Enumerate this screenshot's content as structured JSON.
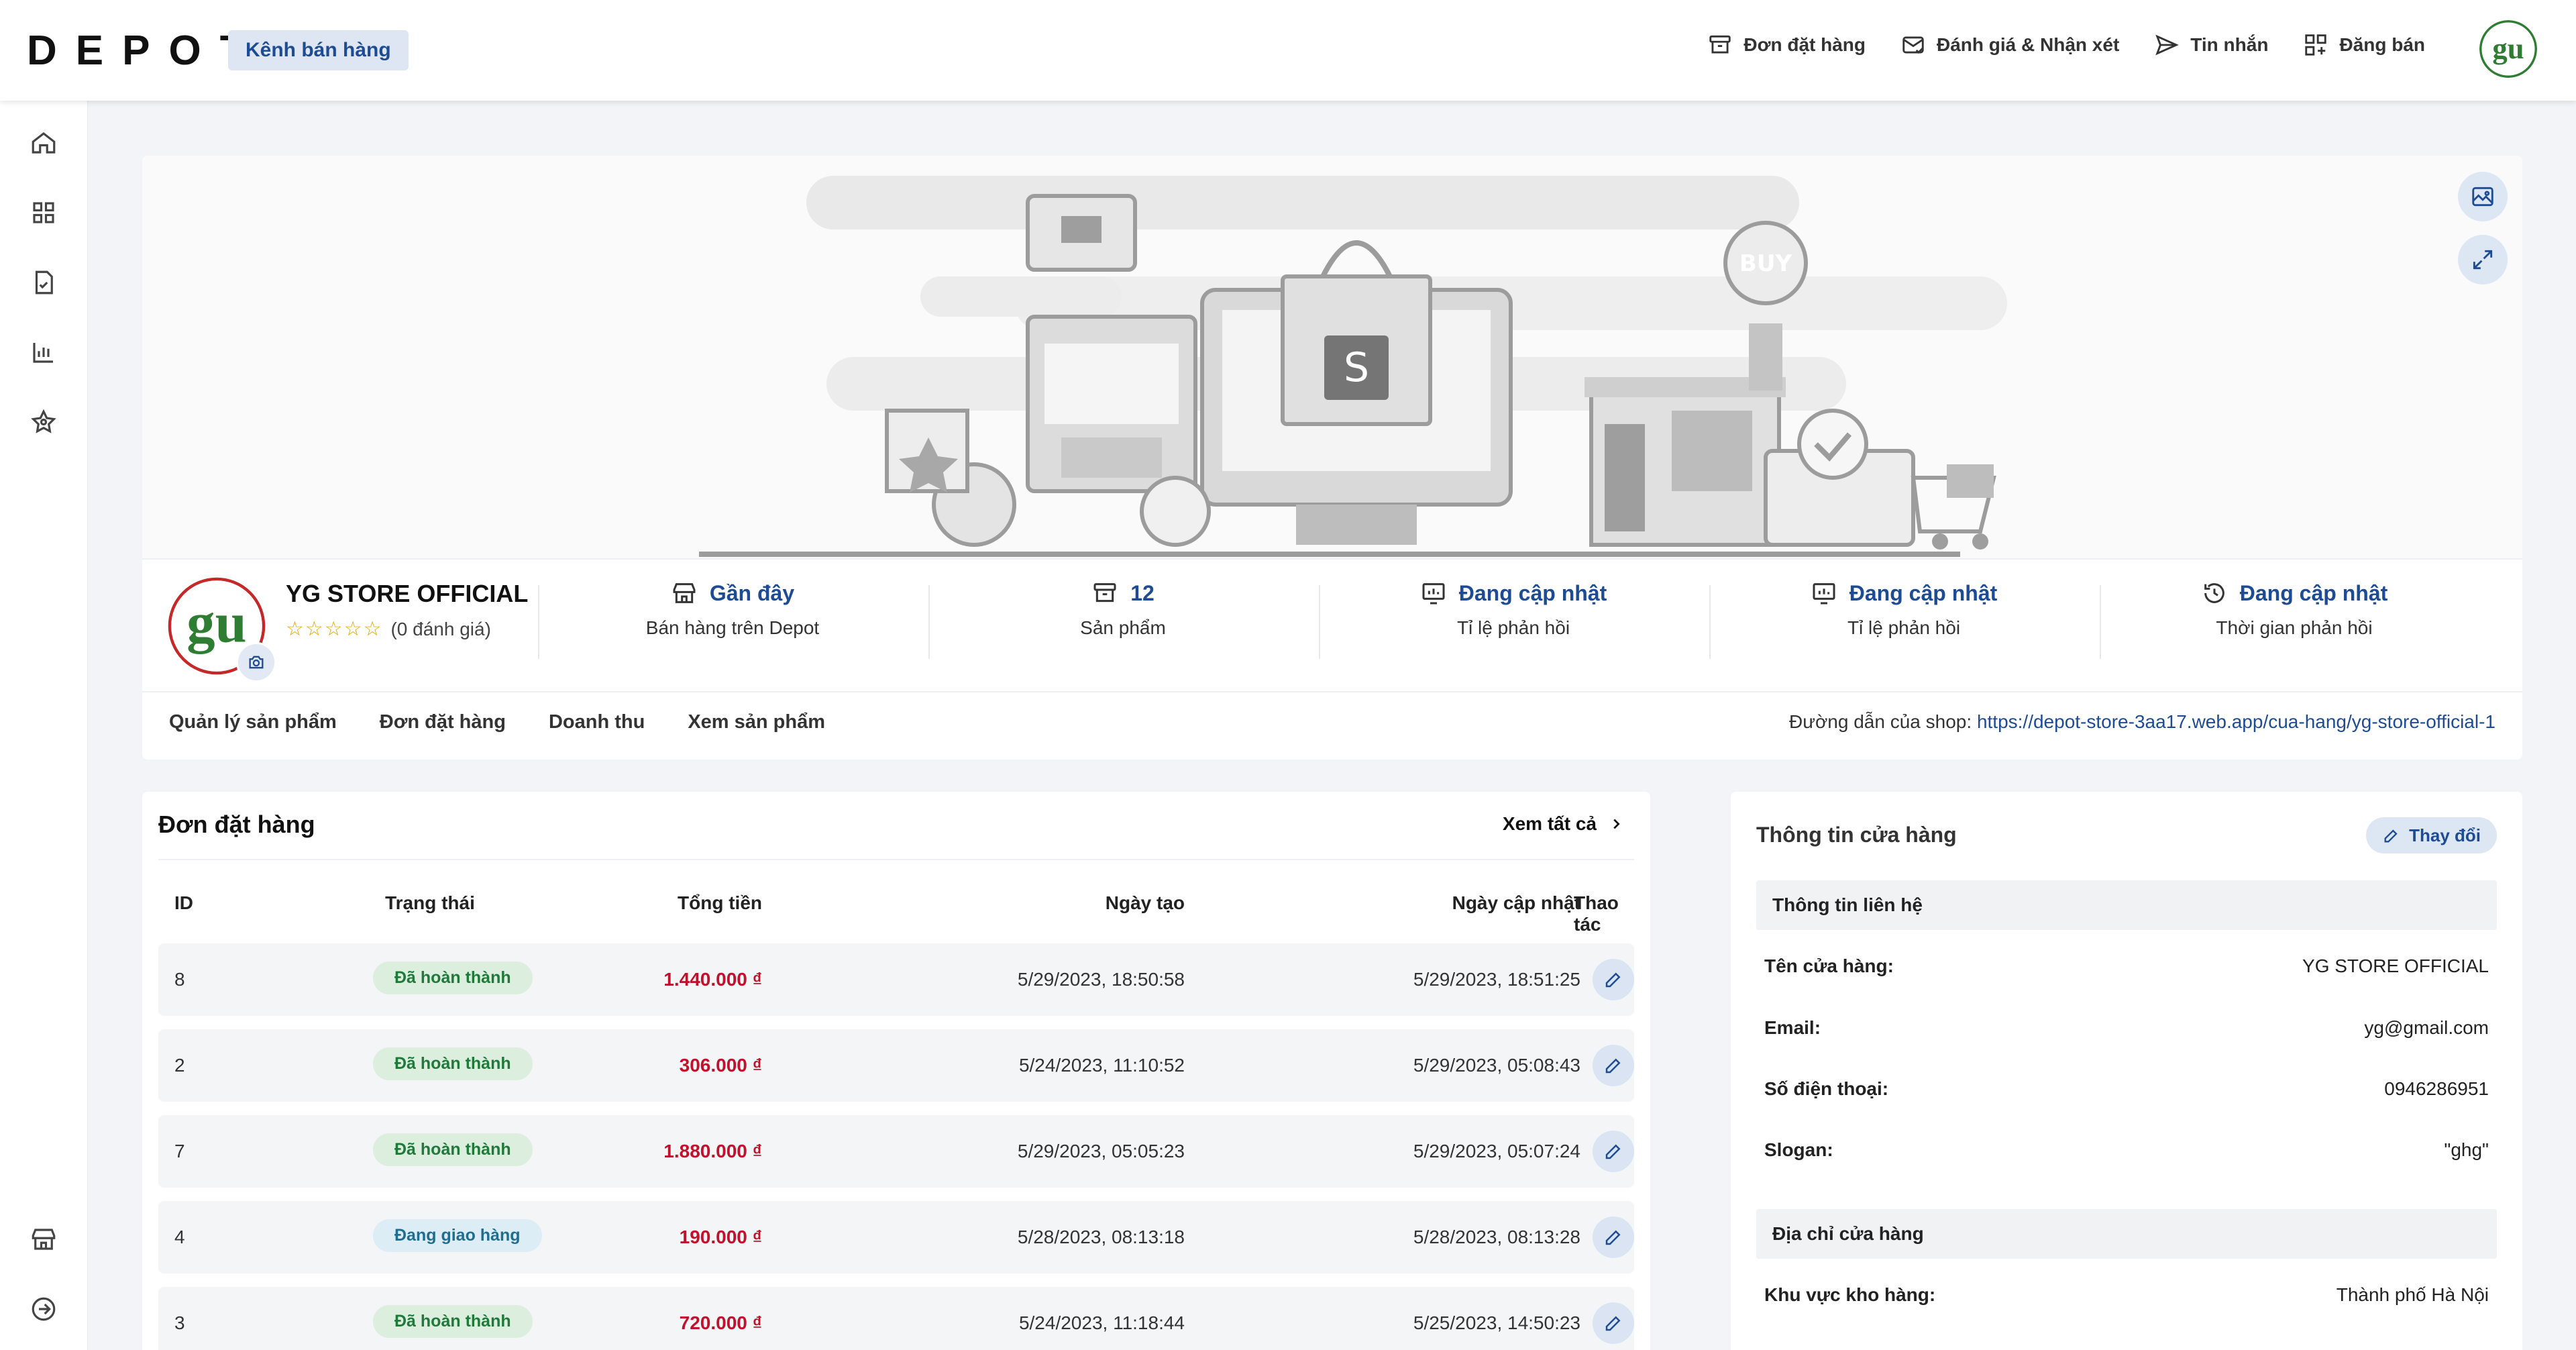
{
  "header": {
    "logo": "DEPOT",
    "channel_badge": "Kênh bán hàng",
    "nav": [
      {
        "label": "Đơn đặt hàng",
        "icon": "archive-icon"
      },
      {
        "label": "Đánh giá & Nhận xét",
        "icon": "mail-check-icon"
      },
      {
        "label": "Tin nhắn",
        "icon": "send-icon"
      },
      {
        "label": "Đăng bán",
        "icon": "grid-plus-icon"
      }
    ]
  },
  "sidebar": {
    "top_items": [
      "home-icon",
      "dashboard-grid-icon",
      "document-check-icon",
      "bar-chart-icon",
      "star-icon"
    ],
    "bottom_items": [
      "store-icon",
      "logout-icon"
    ]
  },
  "shop": {
    "name": "YG STORE OFFICIAL",
    "rating_stars": "☆☆☆☆☆",
    "rating_text": "(0 đánh giá)",
    "stats": [
      {
        "value": "Gần đây",
        "label": "Bán hàng trên Depot",
        "icon": "store-icon"
      },
      {
        "value": "12",
        "label": "Sản phẩm",
        "icon": "box-icon"
      },
      {
        "value": "Đang cập nhật",
        "label": "Tỉ lệ phản hồi",
        "icon": "chart-monitor-icon"
      },
      {
        "value": "Đang cập nhật",
        "label": "Tỉ lệ phản hồi",
        "icon": "chart-monitor-icon"
      },
      {
        "value": "Đang cập nhật",
        "label": "Thời gian phản hồi",
        "icon": "history-icon"
      }
    ],
    "tabs": [
      "Quản lý sản phẩm",
      "Đơn đặt hàng",
      "Doanh thu",
      "Xem sản phẩm"
    ],
    "link_label": "Đường dẫn của shop: ",
    "link_url": "https://depot-store-3aa17.web.app/cua-hang/yg-store-official-1"
  },
  "orders": {
    "title": "Đơn đặt hàng",
    "see_all": "Xem tất cả",
    "columns": [
      "ID",
      "Trạng thái",
      "Tổng tiền",
      "Ngày tạo",
      "Ngày cập nhật",
      "Thao tác"
    ],
    "rows": [
      {
        "id": "8",
        "status": "Đã hoàn thành",
        "status_type": "done",
        "total": "1.440.000 ₫",
        "created": "5/29/2023, 18:50:58",
        "updated": "5/29/2023, 18:51:25"
      },
      {
        "id": "2",
        "status": "Đã hoàn thành",
        "status_type": "done",
        "total": "306.000 ₫",
        "created": "5/24/2023, 11:10:52",
        "updated": "5/29/2023, 05:08:43"
      },
      {
        "id": "7",
        "status": "Đã hoàn thành",
        "status_type": "done",
        "total": "1.880.000 ₫",
        "created": "5/29/2023, 05:05:23",
        "updated": "5/29/2023, 05:07:24"
      },
      {
        "id": "4",
        "status": "Đang giao hàng",
        "status_type": "ship",
        "total": "190.000 ₫",
        "created": "5/28/2023, 08:13:18",
        "updated": "5/28/2023, 08:13:28"
      },
      {
        "id": "3",
        "status": "Đã hoàn thành",
        "status_type": "done",
        "total": "720.000 ₫",
        "created": "5/24/2023, 11:18:44",
        "updated": "5/25/2023, 14:50:23"
      }
    ]
  },
  "store_info": {
    "title": "Thông tin cửa hàng",
    "change_button": "Thay đổi",
    "contact_section": "Thông tin liên hệ",
    "contact": [
      {
        "key": "Tên cửa hàng:",
        "value": "YG STORE OFFICIAL"
      },
      {
        "key": "Email:",
        "value": "yg@gmail.com"
      },
      {
        "key": "Số điện thoại:",
        "value": "0946286951"
      },
      {
        "key": "Slogan:",
        "value": "\"ghg\""
      }
    ],
    "address_section": "Địa chỉ cửa hàng",
    "address": [
      {
        "key": "Khu vực kho hàng:",
        "value": "Thành phố Hà Nội"
      }
    ]
  },
  "colors": {
    "accent": "#1e4c94",
    "money": "#c0122a",
    "done_bg": "#dcefdf",
    "ship_bg": "#dcedf5"
  }
}
